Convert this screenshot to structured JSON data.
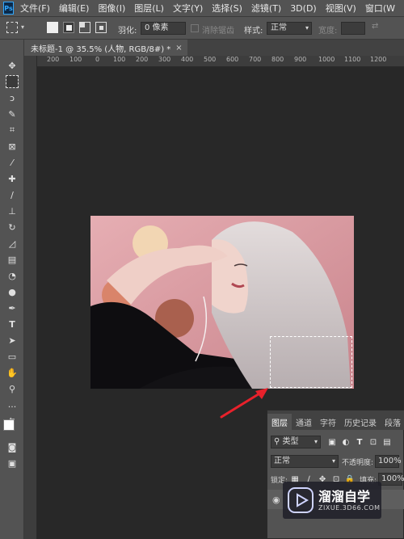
{
  "app": {
    "logo": "Ps"
  },
  "menu": [
    "文件(F)",
    "编辑(E)",
    "图像(I)",
    "图层(L)",
    "文字(Y)",
    "选择(S)",
    "滤镜(T)",
    "3D(D)",
    "视图(V)",
    "窗口(W"
  ],
  "options": {
    "feather_label": "羽化:",
    "feather_value": "0 像素",
    "antialias_label": "消除锯齿",
    "style_label": "样式:",
    "style_value": "正常",
    "width_label": "宽度:"
  },
  "document": {
    "tab_title": "未标题-1 @ 35.5% (人物, RGB/8#) *",
    "close_glyph": "×"
  },
  "rulers": {
    "top_ticks": [
      "200",
      "100",
      "0",
      "100",
      "200",
      "300",
      "400",
      "500",
      "600",
      "700",
      "800",
      "900",
      "1000",
      "1100",
      "1200"
    ]
  },
  "layers_panel": {
    "tabs": [
      "图层",
      "通道",
      "字符",
      "历史记录",
      "段落"
    ],
    "filter_kind": "类型",
    "blend_mode": "正常",
    "opacity_label": "不透明度:",
    "opacity_value": "100%",
    "lock_label": "锁定:",
    "fill_label": "填充:",
    "fill_value": "100%"
  },
  "watermark": {
    "title": "溜溜自学",
    "url": "ZIXUE.3D66.COM"
  },
  "colors": {
    "ui_panel": "#535353",
    "canvas_bg": "#282828",
    "arrow": "#e8212b",
    "photo_bg": "#d9969b"
  }
}
